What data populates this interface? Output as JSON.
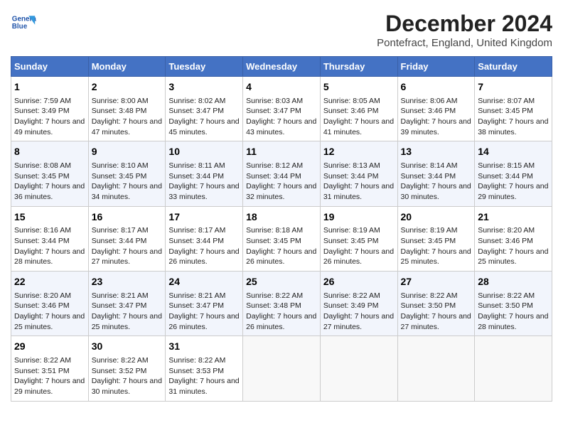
{
  "logo": {
    "line1": "General",
    "line2": "Blue"
  },
  "title": "December 2024",
  "subtitle": "Pontefract, England, United Kingdom",
  "days_of_week": [
    "Sunday",
    "Monday",
    "Tuesday",
    "Wednesday",
    "Thursday",
    "Friday",
    "Saturday"
  ],
  "weeks": [
    [
      {
        "day": "1",
        "sunrise": "Sunrise: 7:59 AM",
        "sunset": "Sunset: 3:49 PM",
        "daylight": "Daylight: 7 hours and 49 minutes."
      },
      {
        "day": "2",
        "sunrise": "Sunrise: 8:00 AM",
        "sunset": "Sunset: 3:48 PM",
        "daylight": "Daylight: 7 hours and 47 minutes."
      },
      {
        "day": "3",
        "sunrise": "Sunrise: 8:02 AM",
        "sunset": "Sunset: 3:47 PM",
        "daylight": "Daylight: 7 hours and 45 minutes."
      },
      {
        "day": "4",
        "sunrise": "Sunrise: 8:03 AM",
        "sunset": "Sunset: 3:47 PM",
        "daylight": "Daylight: 7 hours and 43 minutes."
      },
      {
        "day": "5",
        "sunrise": "Sunrise: 8:05 AM",
        "sunset": "Sunset: 3:46 PM",
        "daylight": "Daylight: 7 hours and 41 minutes."
      },
      {
        "day": "6",
        "sunrise": "Sunrise: 8:06 AM",
        "sunset": "Sunset: 3:46 PM",
        "daylight": "Daylight: 7 hours and 39 minutes."
      },
      {
        "day": "7",
        "sunrise": "Sunrise: 8:07 AM",
        "sunset": "Sunset: 3:45 PM",
        "daylight": "Daylight: 7 hours and 38 minutes."
      }
    ],
    [
      {
        "day": "8",
        "sunrise": "Sunrise: 8:08 AM",
        "sunset": "Sunset: 3:45 PM",
        "daylight": "Daylight: 7 hours and 36 minutes."
      },
      {
        "day": "9",
        "sunrise": "Sunrise: 8:10 AM",
        "sunset": "Sunset: 3:45 PM",
        "daylight": "Daylight: 7 hours and 34 minutes."
      },
      {
        "day": "10",
        "sunrise": "Sunrise: 8:11 AM",
        "sunset": "Sunset: 3:44 PM",
        "daylight": "Daylight: 7 hours and 33 minutes."
      },
      {
        "day": "11",
        "sunrise": "Sunrise: 8:12 AM",
        "sunset": "Sunset: 3:44 PM",
        "daylight": "Daylight: 7 hours and 32 minutes."
      },
      {
        "day": "12",
        "sunrise": "Sunrise: 8:13 AM",
        "sunset": "Sunset: 3:44 PM",
        "daylight": "Daylight: 7 hours and 31 minutes."
      },
      {
        "day": "13",
        "sunrise": "Sunrise: 8:14 AM",
        "sunset": "Sunset: 3:44 PM",
        "daylight": "Daylight: 7 hours and 30 minutes."
      },
      {
        "day": "14",
        "sunrise": "Sunrise: 8:15 AM",
        "sunset": "Sunset: 3:44 PM",
        "daylight": "Daylight: 7 hours and 29 minutes."
      }
    ],
    [
      {
        "day": "15",
        "sunrise": "Sunrise: 8:16 AM",
        "sunset": "Sunset: 3:44 PM",
        "daylight": "Daylight: 7 hours and 28 minutes."
      },
      {
        "day": "16",
        "sunrise": "Sunrise: 8:17 AM",
        "sunset": "Sunset: 3:44 PM",
        "daylight": "Daylight: 7 hours and 27 minutes."
      },
      {
        "day": "17",
        "sunrise": "Sunrise: 8:17 AM",
        "sunset": "Sunset: 3:44 PM",
        "daylight": "Daylight: 7 hours and 26 minutes."
      },
      {
        "day": "18",
        "sunrise": "Sunrise: 8:18 AM",
        "sunset": "Sunset: 3:45 PM",
        "daylight": "Daylight: 7 hours and 26 minutes."
      },
      {
        "day": "19",
        "sunrise": "Sunrise: 8:19 AM",
        "sunset": "Sunset: 3:45 PM",
        "daylight": "Daylight: 7 hours and 26 minutes."
      },
      {
        "day": "20",
        "sunrise": "Sunrise: 8:19 AM",
        "sunset": "Sunset: 3:45 PM",
        "daylight": "Daylight: 7 hours and 25 minutes."
      },
      {
        "day": "21",
        "sunrise": "Sunrise: 8:20 AM",
        "sunset": "Sunset: 3:46 PM",
        "daylight": "Daylight: 7 hours and 25 minutes."
      }
    ],
    [
      {
        "day": "22",
        "sunrise": "Sunrise: 8:20 AM",
        "sunset": "Sunset: 3:46 PM",
        "daylight": "Daylight: 7 hours and 25 minutes."
      },
      {
        "day": "23",
        "sunrise": "Sunrise: 8:21 AM",
        "sunset": "Sunset: 3:47 PM",
        "daylight": "Daylight: 7 hours and 25 minutes."
      },
      {
        "day": "24",
        "sunrise": "Sunrise: 8:21 AM",
        "sunset": "Sunset: 3:47 PM",
        "daylight": "Daylight: 7 hours and 26 minutes."
      },
      {
        "day": "25",
        "sunrise": "Sunrise: 8:22 AM",
        "sunset": "Sunset: 3:48 PM",
        "daylight": "Daylight: 7 hours and 26 minutes."
      },
      {
        "day": "26",
        "sunrise": "Sunrise: 8:22 AM",
        "sunset": "Sunset: 3:49 PM",
        "daylight": "Daylight: 7 hours and 27 minutes."
      },
      {
        "day": "27",
        "sunrise": "Sunrise: 8:22 AM",
        "sunset": "Sunset: 3:50 PM",
        "daylight": "Daylight: 7 hours and 27 minutes."
      },
      {
        "day": "28",
        "sunrise": "Sunrise: 8:22 AM",
        "sunset": "Sunset: 3:50 PM",
        "daylight": "Daylight: 7 hours and 28 minutes."
      }
    ],
    [
      {
        "day": "29",
        "sunrise": "Sunrise: 8:22 AM",
        "sunset": "Sunset: 3:51 PM",
        "daylight": "Daylight: 7 hours and 29 minutes."
      },
      {
        "day": "30",
        "sunrise": "Sunrise: 8:22 AM",
        "sunset": "Sunset: 3:52 PM",
        "daylight": "Daylight: 7 hours and 30 minutes."
      },
      {
        "day": "31",
        "sunrise": "Sunrise: 8:22 AM",
        "sunset": "Sunset: 3:53 PM",
        "daylight": "Daylight: 7 hours and 31 minutes."
      },
      null,
      null,
      null,
      null
    ]
  ]
}
